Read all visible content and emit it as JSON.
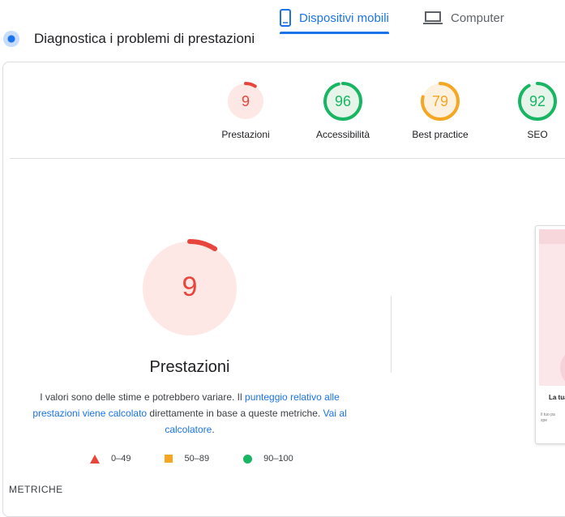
{
  "tabs": {
    "mobile": "Dispositivi mobili",
    "desktop": "Computer"
  },
  "diagnostics_title": "Diagnostica i problemi di prestazioni",
  "gauges": [
    {
      "score": "9",
      "label": "Prestazioni",
      "value": 9,
      "color": "#e8453c",
      "fill": "#fde8e6"
    },
    {
      "score": "96",
      "label": "Accessibilità",
      "value": 96,
      "color": "#18b663",
      "fill": "#e6f4ea"
    },
    {
      "score": "79",
      "label": "Best practice",
      "value": 79,
      "color": "#f5a623",
      "fill": "#fef1e0"
    },
    {
      "score": "92",
      "label": "SEO",
      "value": 92,
      "color": "#18b663",
      "fill": "#e6f4ea"
    }
  ],
  "main_gauge": {
    "score": "9",
    "value": 9,
    "title": "Prestazioni",
    "color": "#e8453c",
    "fill": "#fde8e6"
  },
  "description": {
    "part1": "I valori sono delle stime e potrebbero variare. Il ",
    "link1": "punteggio relativo alle prestazioni viene calcolato",
    "part2": " direttamente in base a queste metriche. ",
    "link2": "Vai al calcolatore",
    "part3": "."
  },
  "legend": {
    "low": "0–49",
    "mid": "50–89",
    "high": "90–100"
  },
  "metrics_title": "METRICHE",
  "screenshot": {
    "heading": "La tua",
    "line1": "Il tuo pa",
    "line2": "spe"
  }
}
